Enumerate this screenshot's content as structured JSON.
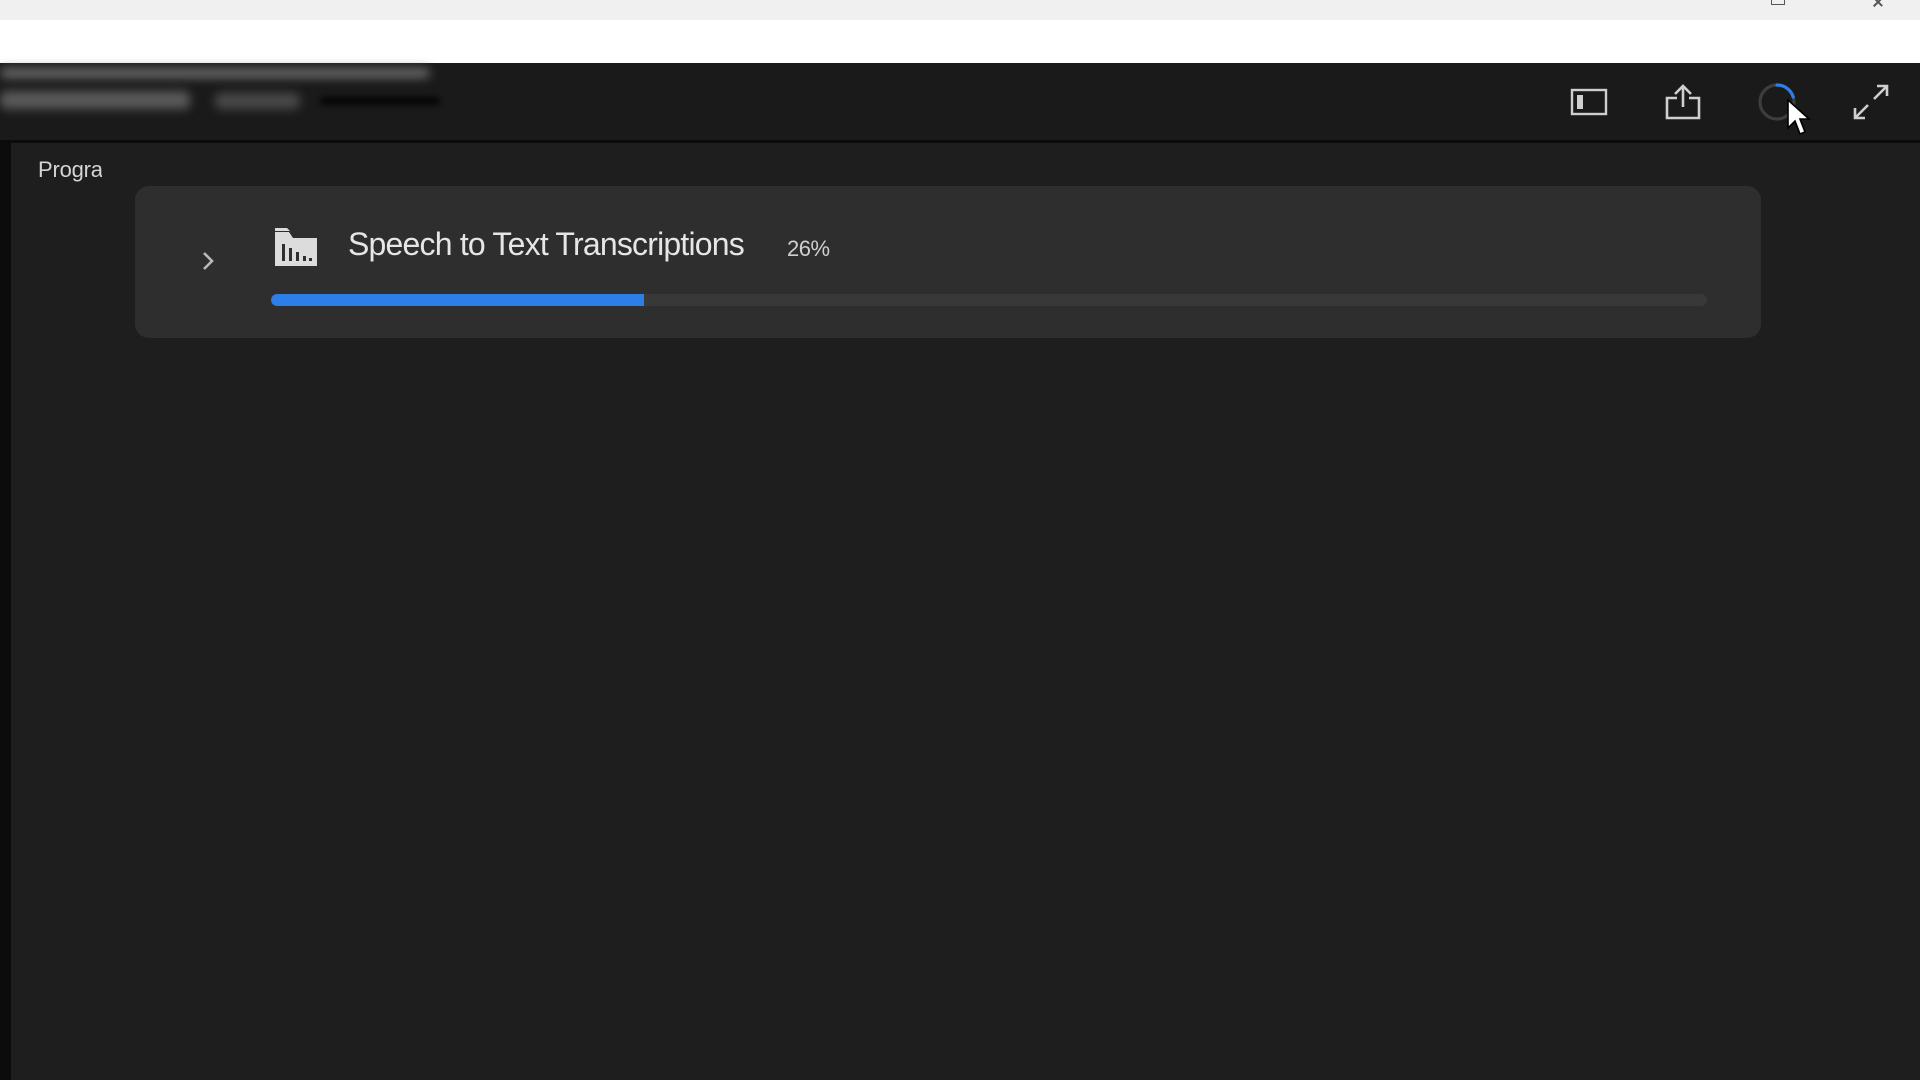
{
  "window": {
    "restore_icon": "restore-icon",
    "close_icon": "close-icon"
  },
  "header": {
    "icons": [
      {
        "name": "panel-toggle-icon"
      },
      {
        "name": "share-export-icon"
      },
      {
        "name": "progress-spinner-icon"
      },
      {
        "name": "expand-fullscreen-icon"
      }
    ],
    "accent_color": "#2d7ee8"
  },
  "panel": {
    "label": "Progra"
  },
  "task": {
    "icon": "transcription-folder-icon",
    "title": "Speech to Text Transcriptions",
    "percent_label": "26%",
    "progress": 0.26,
    "progress_color": "#2d7ee8"
  }
}
